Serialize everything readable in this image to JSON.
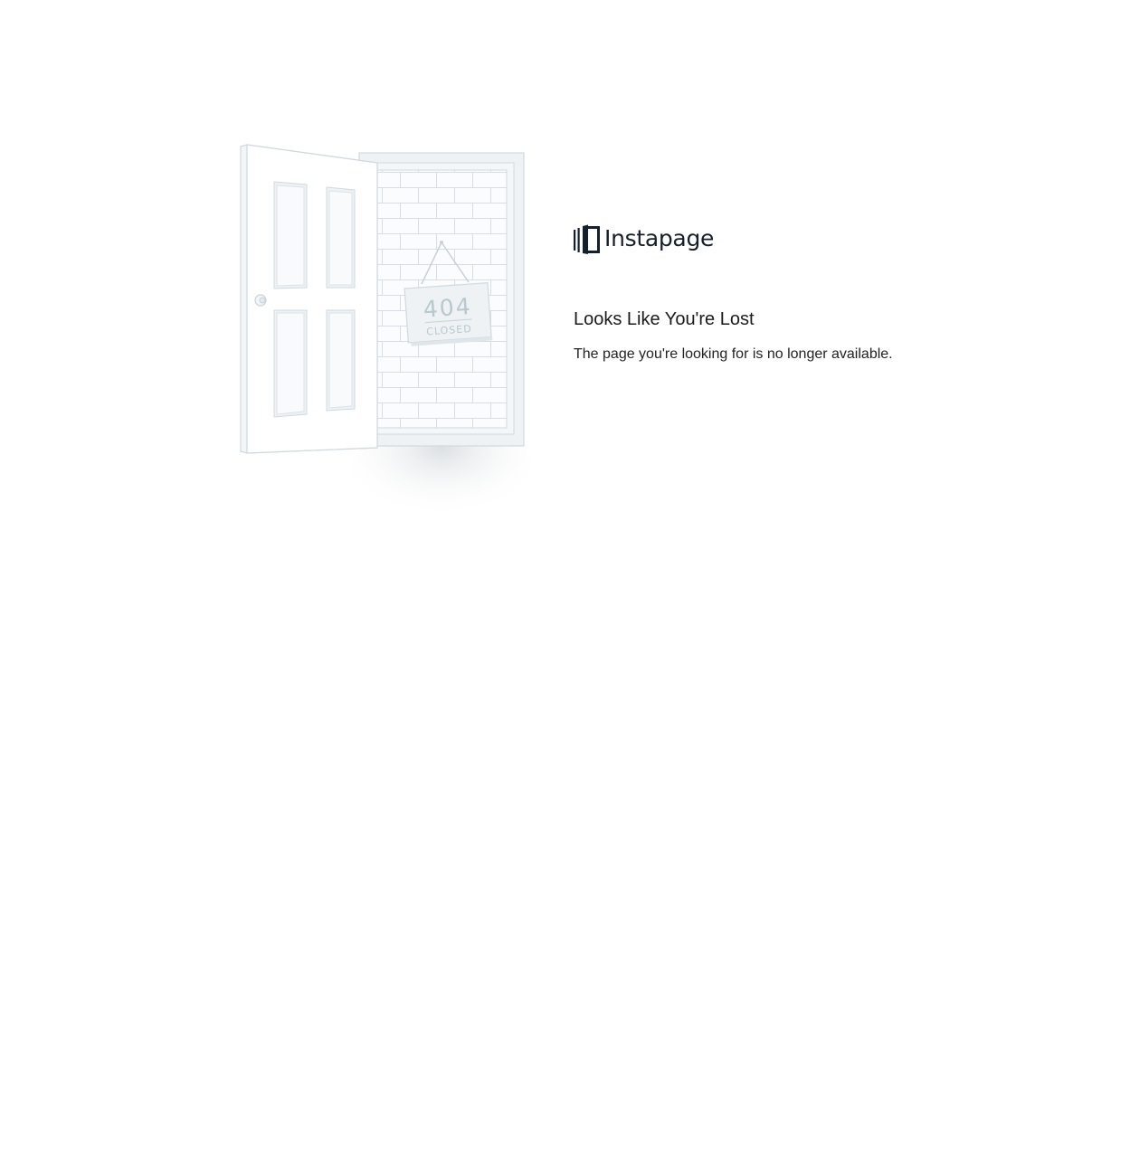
{
  "logo": {
    "text": "Instapage",
    "icon": "instapage-logo-icon"
  },
  "error": {
    "illustration_code": "404",
    "illustration_sign": "CLOSED",
    "title": "Looks Like You're Lost",
    "message": "The page you're looking for is no longer available."
  },
  "colors": {
    "logo": "#15202e",
    "illustration_line": "#cfd9df",
    "illustration_fill": "#eef2f4",
    "text": "#1b1b1b"
  }
}
